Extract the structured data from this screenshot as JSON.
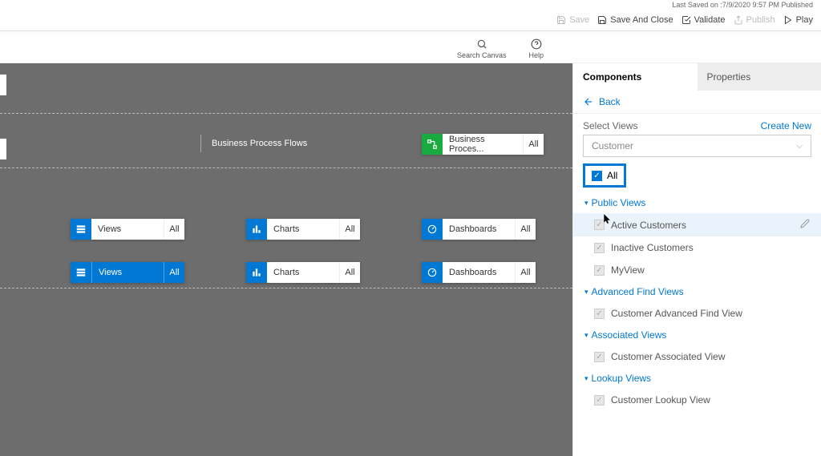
{
  "meta": {
    "last_saved": "Last Saved on :7/9/2020 9:57 PM Published"
  },
  "toolbar": {
    "save": "Save",
    "save_close": "Save And Close",
    "validate": "Validate",
    "publish": "Publish",
    "play": "Play"
  },
  "subbar": {
    "search": "Search Canvas",
    "help": "Help"
  },
  "canvas": {
    "bpf_label": "Business Process Flows",
    "bpf_tile": "Business Proces...",
    "all": "All",
    "views": "Views",
    "charts": "Charts",
    "dashboards": "Dashboards"
  },
  "panel": {
    "tab_components": "Components",
    "tab_properties": "Properties",
    "back": "Back",
    "select_views": "Select Views",
    "create_new": "Create New",
    "entity": "Customer",
    "all": "All",
    "groups": {
      "public": "Public Views",
      "advanced": "Advanced Find Views",
      "associated": "Associated Views",
      "lookup": "Lookup Views"
    },
    "items": {
      "active": "Active Customers",
      "inactive": "Inactive Customers",
      "myview": "MyView",
      "adv": "Customer Advanced Find View",
      "assoc": "Customer Associated View",
      "lookup": "Customer Lookup View"
    }
  }
}
